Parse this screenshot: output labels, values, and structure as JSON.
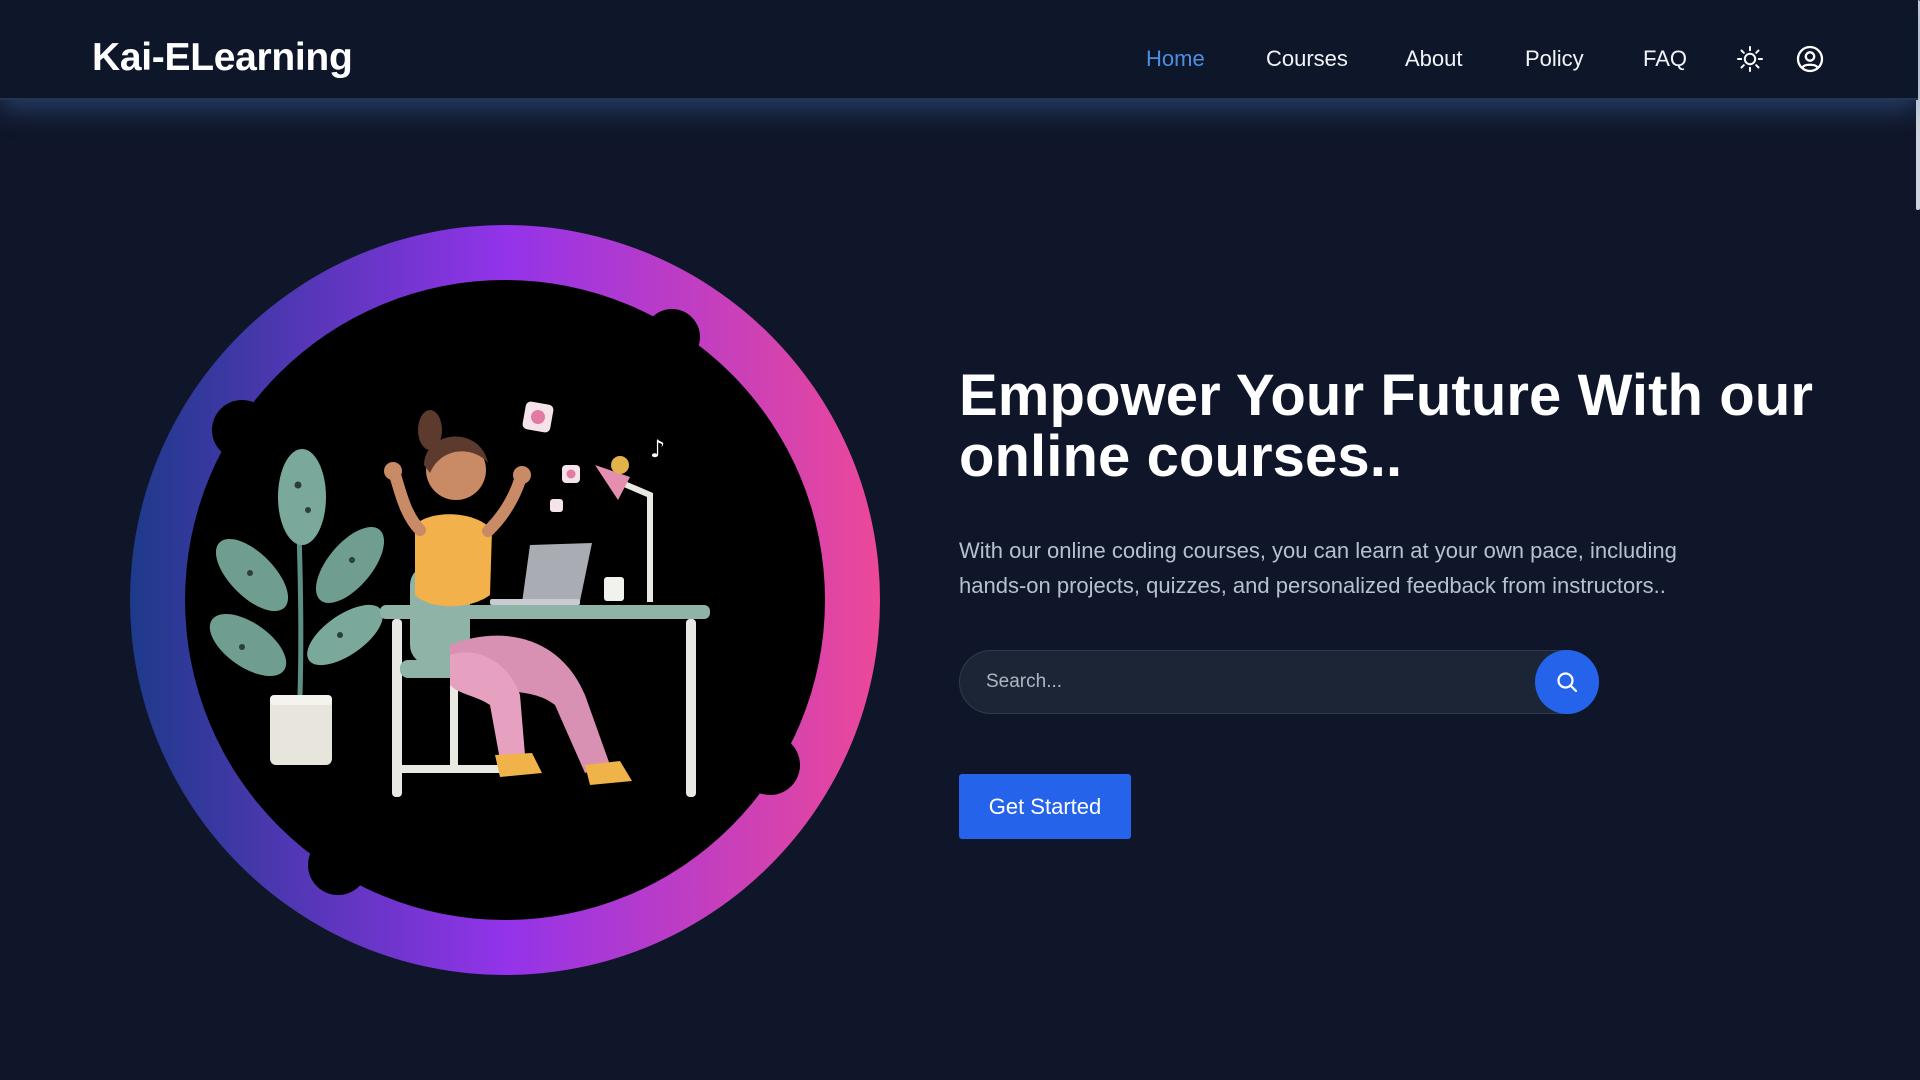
{
  "header": {
    "brand": "Kai-ELearning",
    "nav": [
      {
        "label": "Home",
        "active": true
      },
      {
        "label": "Courses",
        "active": false
      },
      {
        "label": "About",
        "active": false
      },
      {
        "label": "Policy",
        "active": false
      },
      {
        "label": "FAQ",
        "active": false
      }
    ],
    "icons": [
      "sun-icon",
      "user-circle-icon"
    ]
  },
  "hero": {
    "title": "Empower Your Future With our online courses..",
    "description": "With our online coding courses, you can learn at your own pace, including hands-on projects, quizzes, and personalized feedback from instructors..",
    "search": {
      "placeholder": "Search...",
      "value": "",
      "button_icon": "search-icon"
    },
    "cta_label": "Get Started",
    "illustration": "woman-at-desk-with-laptop"
  },
  "colors": {
    "background": "#0f1629",
    "nav_active": "#4a8fe0",
    "primary": "#2563eb",
    "ring_gradient": [
      "#1e3a8a",
      "#9333ea",
      "#ec4899"
    ]
  }
}
